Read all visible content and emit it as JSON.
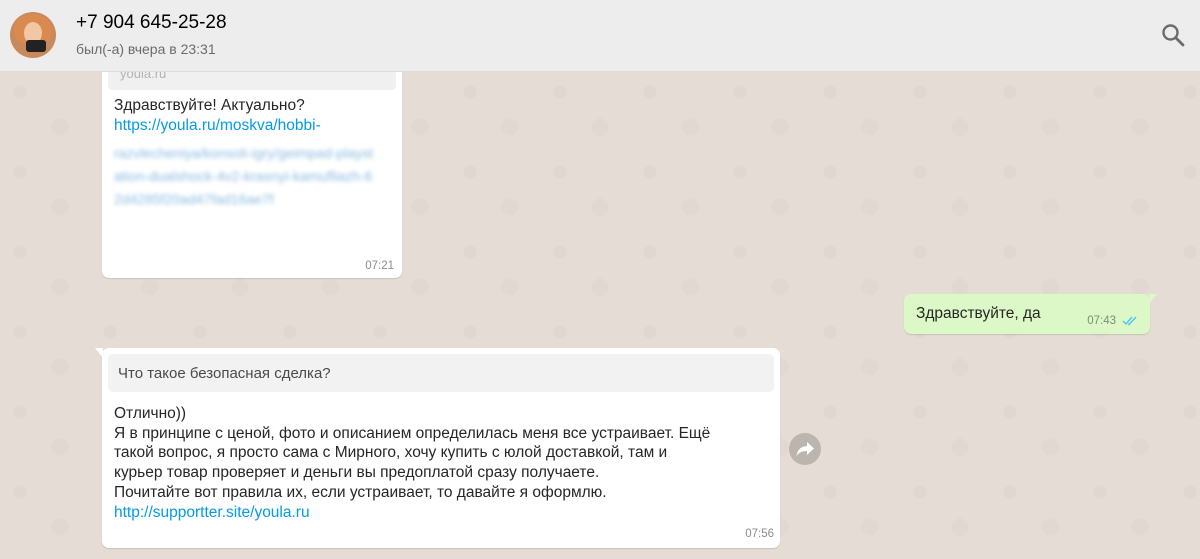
{
  "header": {
    "contact_name": "+7 904 645-25-28",
    "status": "был(-а) вчера в 23:31",
    "search_icon": "search-icon",
    "avatar_icon": "avatar"
  },
  "messages": [
    {
      "direction": "incoming",
      "preview_domain": "youla.ru",
      "text": "Здравствуйте! Актуально?",
      "link": "https://youla.ru/moskva/hobbi-",
      "link_blurred": "razvlecheniya/konsoli-igry/geimpad-playstation-dualshock-4v2-krasnyi-kamufliazh-62d4285f20ad47fad16ae7f",
      "time": "07:21"
    },
    {
      "direction": "outgoing",
      "text": "Здравствуйте, да",
      "time": "07:43",
      "read_icon": "double-check-icon"
    },
    {
      "direction": "incoming",
      "quoted_text": "Что такое безопасная сделка?",
      "lines": [
        "Отлично))",
        "Я в принципе с ценой, фото и описанием определилась меня все устраивает. Ещё",
        "такой вопрос, я просто сама с Мирного, хочу купить с юлой доставкой, там и",
        "курьер товар проверяет и деньги вы предоплатой сразу получаете.",
        "Почитайте вот правила их, если устраивает, то давайте я оформлю."
      ],
      "link": "http://supportter.site/youla.ru",
      "time": "07:56",
      "forward_icon": "forward-icon"
    }
  ],
  "colors": {
    "header_bg": "#ededed",
    "chat_bg": "#e5ddd5",
    "outgoing_bubble": "#dcf8c6",
    "link": "#039be5",
    "read_check": "#4fc3f7"
  }
}
